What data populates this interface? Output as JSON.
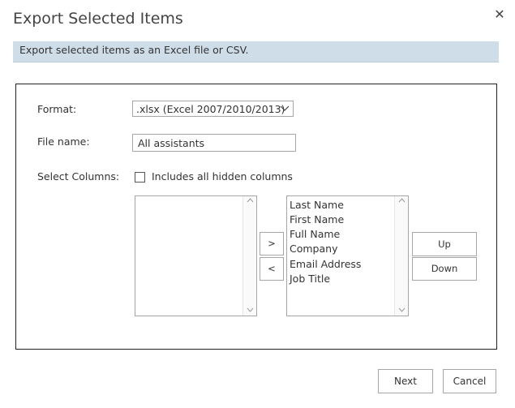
{
  "dialog": {
    "title": "Export Selected Items",
    "close_glyph": "✕",
    "banner_text": "Export selected items as an Excel file or CSV."
  },
  "form": {
    "format_label": "Format:",
    "format_value": ".xlsx (Excel 2007/2010/2013)",
    "file_name_label": "File name:",
    "file_name_value": "All assistants",
    "select_columns_label": "Select Columns:",
    "hidden_columns_checkbox_label": "Includes all hidden columns",
    "hidden_columns_checked": false
  },
  "columns": {
    "available": [],
    "selected": [
      "Last Name",
      "First Name",
      "Full Name",
      "Company",
      "Email Address",
      "Job Title"
    ],
    "move_right_label": ">",
    "move_left_label": "<",
    "up_label": "Up",
    "down_label": "Down"
  },
  "footer": {
    "next_label": "Next",
    "cancel_label": "Cancel"
  },
  "icons": {
    "close": "close-icon",
    "dropdown": "chevron-down-icon",
    "scroll_up": "scroll-up-arrow-icon",
    "scroll_down": "scroll-down-arrow-icon"
  },
  "colors": {
    "banner_bg": "#cfdde9",
    "panel_border": "#222222",
    "control_border": "#a6a6a6"
  }
}
